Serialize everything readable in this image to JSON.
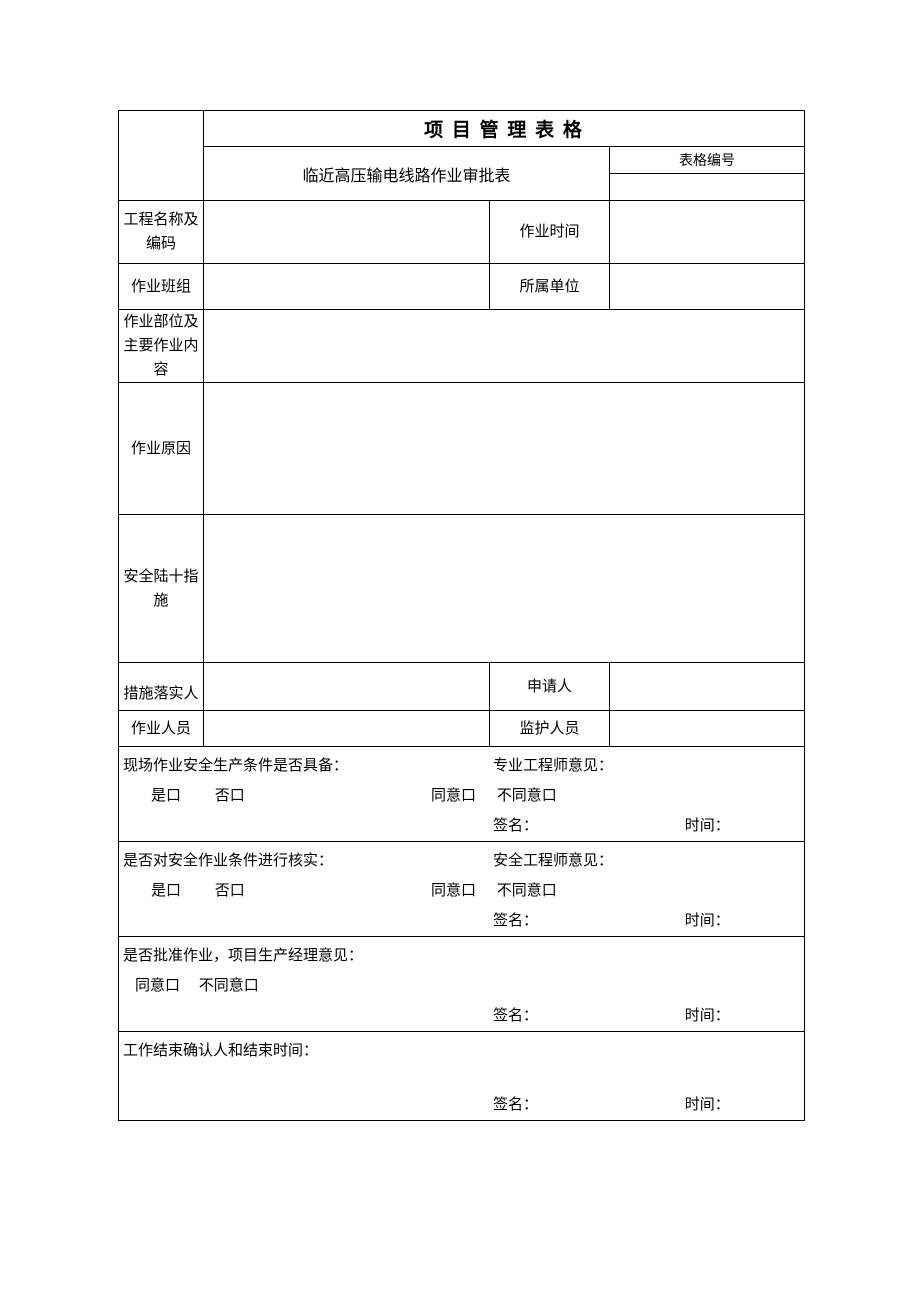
{
  "header": {
    "title": "项 目 管 理 表 格",
    "subtitle": "临近高压输电线路作业审批表",
    "form_no_label": "表格编号"
  },
  "labels": {
    "proj_name": "工程名称及编码",
    "work_time": "作业时间",
    "team": "作业班组",
    "unit": "所属单位",
    "part_content": "作业部位及主要作业内容",
    "reason": "作业原因",
    "measures": "安全陆十指施",
    "impl_person": "措施落实人",
    "applicant": "申请人",
    "workers": "作业人员",
    "guardian": "监护人员"
  },
  "sections": {
    "s1": {
      "left_q": "现场作业安全生产条件是否具备：",
      "right_q": "专业工程师意见：",
      "yes": "是口",
      "no": "否口",
      "agree": "同意口",
      "disagree": "不同意口",
      "sign": "签名：",
      "time": "时间："
    },
    "s2": {
      "left_q": "是否对安全作业条件进行核实：",
      "right_q": "安全工程师意见：",
      "yes": "是口",
      "no": "否口",
      "agree": "同意口",
      "disagree": "不同意口",
      "sign": "签名：",
      "time": "时间："
    },
    "s3": {
      "q": "是否批准作业，项目生产经理意见：",
      "agree": "同意口",
      "disagree": "不同意口",
      "sign": "签名：",
      "time": "时间："
    },
    "s4": {
      "q": "工作结束确认人和结束时间：",
      "sign": "签名：",
      "time": "时间："
    }
  }
}
